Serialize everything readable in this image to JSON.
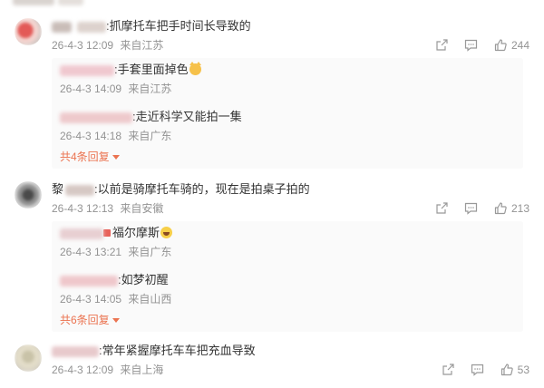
{
  "comments": [
    {
      "text": ":抓摩托车把手时间长导致的",
      "date": "26-4-3 12:09",
      "location": "来自江苏",
      "likes": "244",
      "replies": [
        {
          "text": ":手套里面掉色",
          "date": "26-4-3 14:09",
          "location": "来自江苏",
          "emoji": "cat-emoji"
        },
        {
          "text": ":走近科学又能拍一集",
          "date": "26-4-3 14:18",
          "location": "来自广东"
        }
      ],
      "more_label": "共4条回复"
    },
    {
      "name_visible": "黎",
      "text": ":以前是骑摩托车骑的，现在是拍桌子拍的",
      "date": "26-4-3 12:13",
      "location": "来自安徽",
      "likes": "213",
      "replies": [
        {
          "text": "福尔摩斯",
          "date": "26-4-3 13:21",
          "location": "来自广东",
          "emoji": "laughing-emoji"
        },
        {
          "text": ":如梦初醒",
          "date": "26-4-3 14:05",
          "location": "来自山西"
        }
      ],
      "more_label": "共6条回复"
    },
    {
      "text": ":常年紧握摩托车车把充血导致",
      "date": "26-4-3 12:09",
      "location": "来自上海",
      "likes": "53"
    }
  ],
  "icons": {
    "share": "share-icon",
    "comment": "comment-icon",
    "like": "thumbs-up-icon"
  },
  "colors": {
    "more_link": "#eb7350",
    "meta_text": "#939393",
    "reply_bg": "#fafafa"
  }
}
